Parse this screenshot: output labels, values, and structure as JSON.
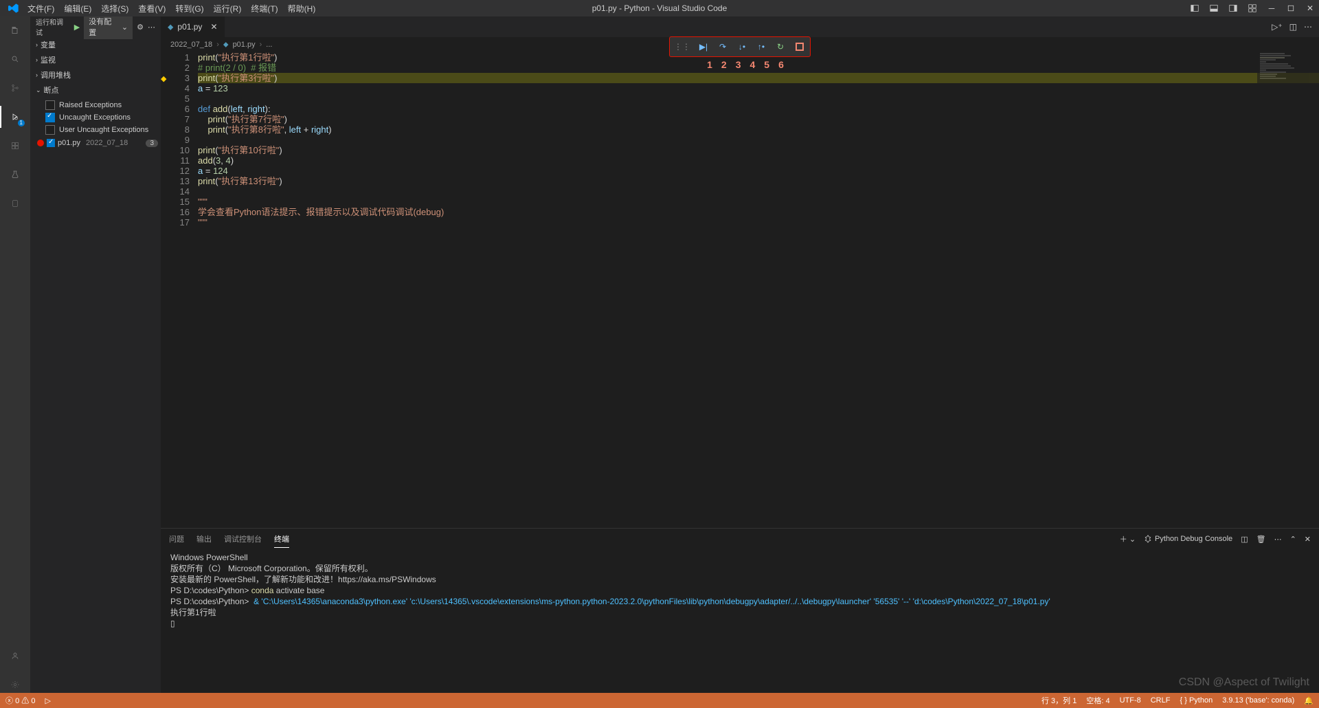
{
  "window": {
    "title": "p01.py - Python - Visual Studio Code"
  },
  "menu": {
    "file": "文件(F)",
    "edit": "编辑(E)",
    "select": "选择(S)",
    "view": "查看(V)",
    "go": "转到(G)",
    "run": "运行(R)",
    "terminal": "终端(T)",
    "help": "帮助(H)"
  },
  "sidebar": {
    "title": "运行和调试",
    "noconfig": "没有配置",
    "sections": {
      "vars": "变量",
      "watch": "监视",
      "callstack": "调用堆栈",
      "breakpoints": "断点"
    },
    "exceptions": {
      "raised": {
        "label": "Raised Exceptions",
        "checked": false
      },
      "uncaught": {
        "label": "Uncaught Exceptions",
        "checked": true
      },
      "user": {
        "label": "User Uncaught Exceptions",
        "checked": false
      }
    },
    "bpfile": {
      "name": "p01.py",
      "path": "2022_07_18",
      "count": "3"
    }
  },
  "tab": {
    "name": "p01.py"
  },
  "breadcrumb": {
    "folder": "2022_07_18",
    "file": "p01.py",
    "more": "..."
  },
  "debug_numbers": [
    "1",
    "2",
    "3",
    "4",
    "5",
    "6"
  ],
  "code": {
    "lines": [
      {
        "n": 1,
        "bp": "",
        "tokens": [
          [
            "fn",
            "print"
          ],
          [
            "pn",
            "("
          ],
          [
            "str",
            "\"执行第1行啦\""
          ],
          [
            "pn",
            ")"
          ]
        ]
      },
      {
        "n": 2,
        "bp": "",
        "tokens": [
          [
            "cmt",
            "# print(2 / 0)  # 报错"
          ]
        ]
      },
      {
        "n": 3,
        "bp": "arrow",
        "hl": true,
        "tokens": [
          [
            "fn",
            "print"
          ],
          [
            "pn",
            "("
          ],
          [
            "str",
            "\"执行第3行啦\""
          ],
          [
            "pn",
            ")"
          ]
        ]
      },
      {
        "n": 4,
        "bp": "",
        "tokens": [
          [
            "var",
            "a"
          ],
          [
            "pn",
            " = "
          ],
          [
            "num",
            "123"
          ]
        ]
      },
      {
        "n": 5,
        "bp": "",
        "tokens": []
      },
      {
        "n": 6,
        "bp": "",
        "tokens": [
          [
            "kw",
            "def "
          ],
          [
            "fn",
            "add"
          ],
          [
            "pn",
            "("
          ],
          [
            "var",
            "left"
          ],
          [
            "pn",
            ", "
          ],
          [
            "var",
            "right"
          ],
          [
            "pn",
            "):"
          ]
        ]
      },
      {
        "n": 7,
        "bp": "",
        "indent": 1,
        "tokens": [
          [
            "fn",
            "print"
          ],
          [
            "pn",
            "("
          ],
          [
            "str",
            "\"执行第7行啦\""
          ],
          [
            "pn",
            ")"
          ]
        ]
      },
      {
        "n": 8,
        "bp": "",
        "indent": 1,
        "tokens": [
          [
            "fn",
            "print"
          ],
          [
            "pn",
            "("
          ],
          [
            "str",
            "\"执行第8行啦\""
          ],
          [
            "pn",
            ", "
          ],
          [
            "var",
            "left"
          ],
          [
            "pn",
            " + "
          ],
          [
            "var",
            "right"
          ],
          [
            "pn",
            ")"
          ]
        ]
      },
      {
        "n": 9,
        "bp": "",
        "tokens": []
      },
      {
        "n": 10,
        "bp": "",
        "tokens": [
          [
            "fn",
            "print"
          ],
          [
            "pn",
            "("
          ],
          [
            "str",
            "\"执行第10行啦\""
          ],
          [
            "pn",
            ")"
          ]
        ]
      },
      {
        "n": 11,
        "bp": "",
        "tokens": [
          [
            "fn",
            "add"
          ],
          [
            "pn",
            "("
          ],
          [
            "num",
            "3"
          ],
          [
            "pn",
            ", "
          ],
          [
            "num",
            "4"
          ],
          [
            "pn",
            ")"
          ]
        ]
      },
      {
        "n": 12,
        "bp": "",
        "tokens": [
          [
            "var",
            "a"
          ],
          [
            "pn",
            " = "
          ],
          [
            "num",
            "124"
          ]
        ]
      },
      {
        "n": 13,
        "bp": "",
        "tokens": [
          [
            "fn",
            "print"
          ],
          [
            "pn",
            "("
          ],
          [
            "str",
            "\"执行第13行啦\""
          ],
          [
            "pn",
            ")"
          ]
        ]
      },
      {
        "n": 14,
        "bp": "",
        "tokens": []
      },
      {
        "n": 15,
        "bp": "",
        "tokens": [
          [
            "str",
            "\"\"\""
          ]
        ]
      },
      {
        "n": 16,
        "bp": "",
        "tokens": [
          [
            "str",
            "学会查看Python语法提示、报错提示以及调试代码调试(debug)"
          ]
        ]
      },
      {
        "n": 17,
        "bp": "",
        "tokens": [
          [
            "str",
            "\"\"\""
          ]
        ]
      }
    ]
  },
  "panel": {
    "tabs": {
      "problems": "问题",
      "output": "输出",
      "debug": "调试控制台",
      "terminal": "终端"
    },
    "console_label": "Python Debug Console",
    "terminal_lines": [
      "Windows PowerShell",
      "版权所有（C） Microsoft Corporation。保留所有权利。",
      "",
      "安装最新的 PowerShell，了解新功能和改进！https://aka.ms/PSWindows",
      "",
      {
        "prompt": "PS D:\\codes\\Python> ",
        "cmd": "conda",
        "args": " activate base"
      },
      {
        "prompt": "PS D:\\codes\\Python> ",
        "long": " & 'C:\\Users\\14365\\anaconda3\\python.exe' 'c:\\Users\\14365\\.vscode\\extensions\\ms-python.python-2023.2.0\\pythonFiles\\lib\\python\\debugpy\\adapter/../..\\debugpy\\launcher' '56535' '--' 'd:\\codes\\Python\\2022_07_18\\p01.py'"
      },
      "执行第1行啦",
      "▯"
    ]
  },
  "status": {
    "errors": "0",
    "warnings": "0",
    "ln": "行 3，列 1",
    "spaces": "空格: 4",
    "enc": "UTF-8",
    "eol": "CRLF",
    "lang": "Python",
    "ver": "3.9.13 ('base': conda)"
  },
  "watermark": "CSDN @Aspect of Twilight"
}
